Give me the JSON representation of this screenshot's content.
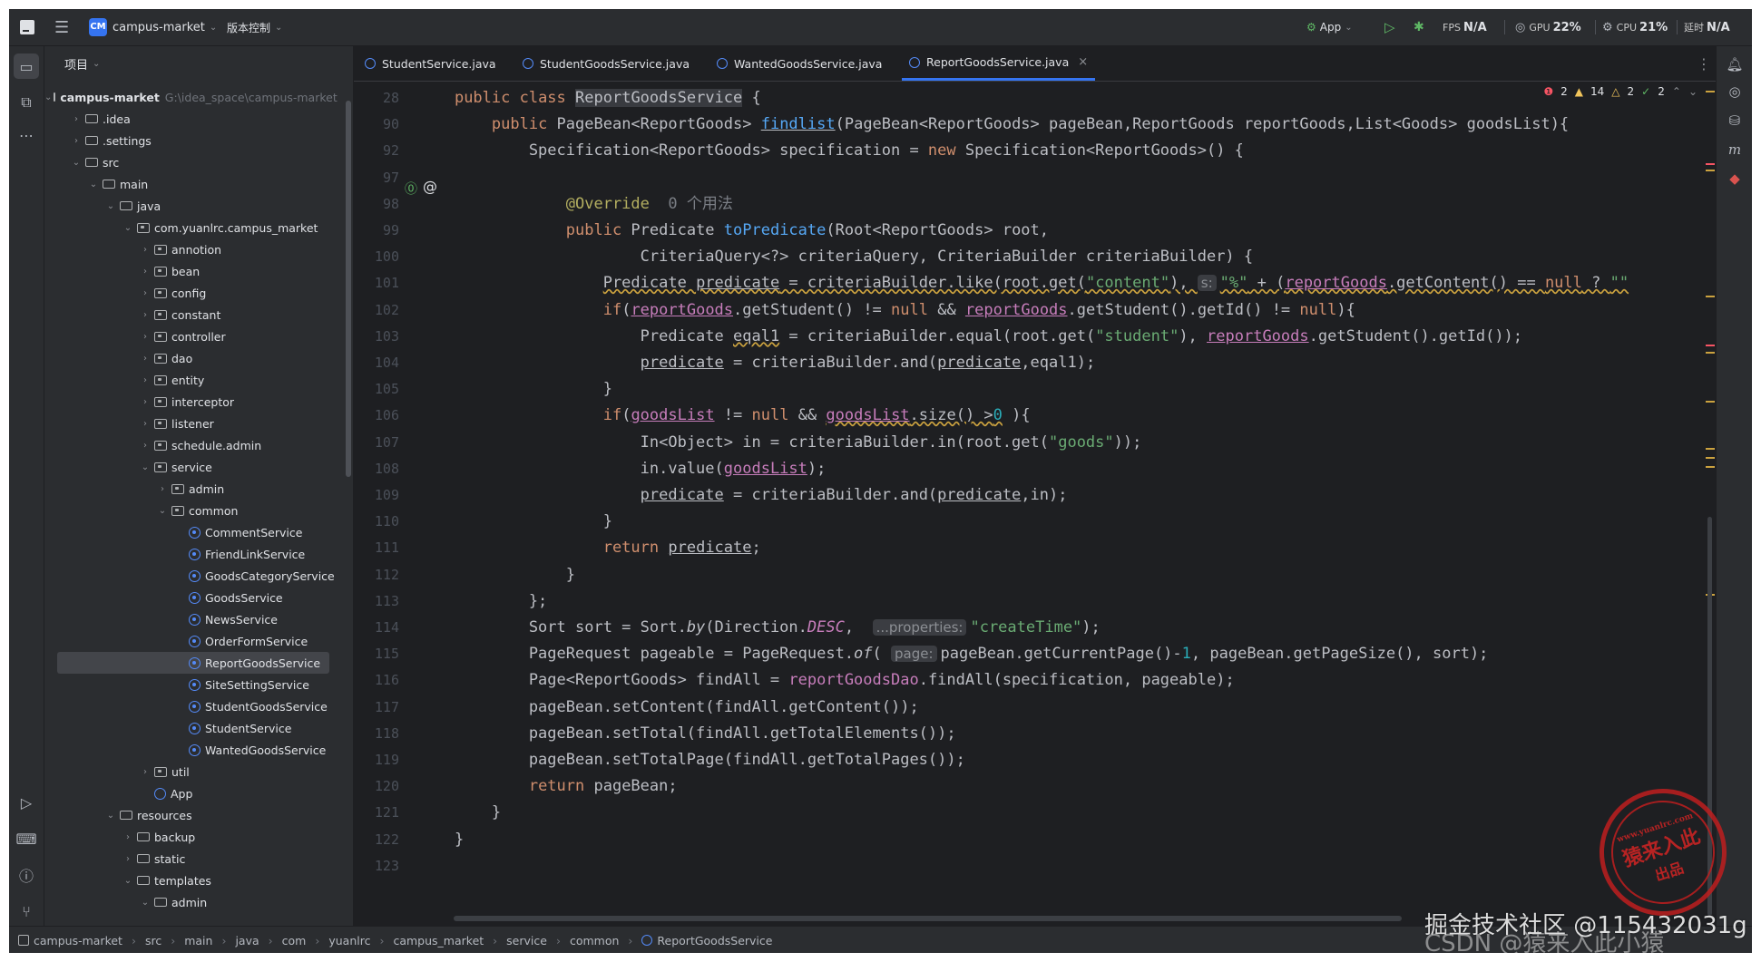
{
  "titlebar": {
    "project_badge": "CM",
    "project_name": "campus-market",
    "vcs": "版本控制",
    "run_config": "App",
    "fps_label": "FPS",
    "fps_value": "N/A",
    "gpu_label": "GPU",
    "gpu_value": "22%",
    "cpu_label": "CPU",
    "cpu_value": "21%",
    "time_label": "延时",
    "time_value": "N/A"
  },
  "project_panel": {
    "header": "项目",
    "tree": [
      {
        "label": "campus-market",
        "path": "G:\\idea_space\\campus-market",
        "indent": 0,
        "arrow": "open",
        "icon": "module",
        "bold": true
      },
      {
        "label": ".idea",
        "indent": 1,
        "arrow": "closed",
        "icon": "folder"
      },
      {
        "label": ".settings",
        "indent": 1,
        "arrow": "closed",
        "icon": "folder"
      },
      {
        "label": "src",
        "indent": 1,
        "arrow": "open",
        "icon": "folder"
      },
      {
        "label": "main",
        "indent": 2,
        "arrow": "open",
        "icon": "folder"
      },
      {
        "label": "java",
        "indent": 3,
        "arrow": "open",
        "icon": "folder"
      },
      {
        "label": "com.yuanlrc.campus_market",
        "indent": 4,
        "arrow": "open",
        "icon": "package"
      },
      {
        "label": "annotion",
        "indent": 5,
        "arrow": "closed",
        "icon": "package"
      },
      {
        "label": "bean",
        "indent": 5,
        "arrow": "closed",
        "icon": "package"
      },
      {
        "label": "config",
        "indent": 5,
        "arrow": "closed",
        "icon": "package"
      },
      {
        "label": "constant",
        "indent": 5,
        "arrow": "closed",
        "icon": "package"
      },
      {
        "label": "controller",
        "indent": 5,
        "arrow": "closed",
        "icon": "package"
      },
      {
        "label": "dao",
        "indent": 5,
        "arrow": "closed",
        "icon": "package"
      },
      {
        "label": "entity",
        "indent": 5,
        "arrow": "closed",
        "icon": "package"
      },
      {
        "label": "interceptor",
        "indent": 5,
        "arrow": "closed",
        "icon": "package"
      },
      {
        "label": "listener",
        "indent": 5,
        "arrow": "closed",
        "icon": "package"
      },
      {
        "label": "schedule.admin",
        "indent": 5,
        "arrow": "closed",
        "icon": "package"
      },
      {
        "label": "service",
        "indent": 5,
        "arrow": "open",
        "icon": "package"
      },
      {
        "label": "admin",
        "indent": 6,
        "arrow": "closed",
        "icon": "package"
      },
      {
        "label": "common",
        "indent": 6,
        "arrow": "open",
        "icon": "package"
      },
      {
        "label": "CommentService",
        "indent": 7,
        "arrow": "",
        "icon": "class"
      },
      {
        "label": "FriendLinkService",
        "indent": 7,
        "arrow": "",
        "icon": "class"
      },
      {
        "label": "GoodsCategoryService",
        "indent": 7,
        "arrow": "",
        "icon": "class"
      },
      {
        "label": "GoodsService",
        "indent": 7,
        "arrow": "",
        "icon": "class"
      },
      {
        "label": "NewsService",
        "indent": 7,
        "arrow": "",
        "icon": "class"
      },
      {
        "label": "OrderFormService",
        "indent": 7,
        "arrow": "",
        "icon": "class"
      },
      {
        "label": "ReportGoodsService",
        "indent": 7,
        "arrow": "",
        "icon": "class",
        "selected": true
      },
      {
        "label": "SiteSettingService",
        "indent": 7,
        "arrow": "",
        "icon": "class"
      },
      {
        "label": "StudentGoodsService",
        "indent": 7,
        "arrow": "",
        "icon": "class"
      },
      {
        "label": "StudentService",
        "indent": 7,
        "arrow": "",
        "icon": "class"
      },
      {
        "label": "WantedGoodsService",
        "indent": 7,
        "arrow": "",
        "icon": "class"
      },
      {
        "label": "util",
        "indent": 5,
        "arrow": "closed",
        "icon": "package"
      },
      {
        "label": "App",
        "indent": 5,
        "arrow": "",
        "icon": "java"
      },
      {
        "label": "resources",
        "indent": 3,
        "arrow": "open",
        "icon": "folder"
      },
      {
        "label": "backup",
        "indent": 4,
        "arrow": "closed",
        "icon": "folder"
      },
      {
        "label": "static",
        "indent": 4,
        "arrow": "closed",
        "icon": "folder"
      },
      {
        "label": "templates",
        "indent": 4,
        "arrow": "open",
        "icon": "folder"
      },
      {
        "label": "admin",
        "indent": 5,
        "arrow": "open",
        "icon": "folder"
      }
    ]
  },
  "tabs": [
    {
      "label": "StudentService.java",
      "active": false
    },
    {
      "label": "StudentGoodsService.java",
      "active": false
    },
    {
      "label": "WantedGoodsService.java",
      "active": false
    },
    {
      "label": "ReportGoodsService.java",
      "active": true
    }
  ],
  "inspections": {
    "errors": "2",
    "warnings": "14",
    "weak_warnings": "2",
    "ok": "2"
  },
  "editor": {
    "lines": [
      {
        "n": "28",
        "html": "    <span class=\"kw\">public class</span> <span class=\"highlight\">ReportGoodsService</span> {"
      },
      {
        "n": "90",
        "html": "        <span class=\"kw\">public</span> PageBean&lt;ReportGoods&gt; <span class=\"fn under\">findlist</span>(PageBean&lt;ReportGoods&gt; pageBean,ReportGoods reportGoods,List&lt;Goods&gt; goodsList){"
      },
      {
        "n": "92",
        "html": "            Specification&lt;ReportGoods&gt; specification = <span class=\"kw\">new</span> Specification&lt;ReportGoods&gt;() {"
      },
      {
        "n": "97",
        "html": ""
      },
      {
        "n": "98",
        "html": "                <span class=\"ann\">@Override</span>  <span class=\"cmt\">0 个用法</span>"
      },
      {
        "n": "99",
        "html": "                <span class=\"kw\">public</span> Predicate <span class=\"fn\">toPredicate</span>(Root&lt;ReportGoods&gt; root,"
      },
      {
        "n": "100",
        "html": "                        CriteriaQuery&lt;?&gt; criteriaQuery, CriteriaBuilder criteriaBuilder) {"
      },
      {
        "n": "101",
        "html": "                    <span class=\"warn\">Predicate <span class=\"under\">predicate</span> = criteriaBuilder.like(root.get(<span class=\"str\">\"content\"</span>), </span><span class=\"hint\">s:</span><span class=\"warn\"><span class=\"str\">\"%\"</span> + (<span class=\"ufld\">reportGoods</span>.getContent() == <span class=\"kw\">null</span> ? <span class=\"str\">\"\"</span></span>"
      },
      {
        "n": "102",
        "html": "                    <span class=\"kw\">if</span>(<span class=\"ufld\">reportGoods</span>.getStudent() != <span class=\"kw\">null</span> &amp;&amp; <span class=\"ufld\">reportGoods</span>.getStudent().getId() != <span class=\"kw\">null</span>){"
      },
      {
        "n": "103",
        "html": "                        Predicate <span class=\"warn\">eqal1</span> = criteriaBuilder.equal(root.get(<span class=\"str\">\"student\"</span>), <span class=\"ufld\">reportGoods</span>.getStudent().getId());"
      },
      {
        "n": "104",
        "html": "                        <span class=\"under\">predicate</span> = criteriaBuilder.and(<span class=\"under\">predicate</span>,eqal1);"
      },
      {
        "n": "105",
        "html": "                    }"
      },
      {
        "n": "106",
        "html": "                    <span class=\"kw\">if</span>(<span class=\"ufld\">goodsList</span> != <span class=\"kw\">null</span> &amp;&amp; <span class=\"warn\"><span class=\"ufld\">goodsList</span>.size() &gt;<span class=\"num\">0</span></span> ){"
      },
      {
        "n": "107",
        "html": "                        In&lt;Object&gt; in = criteriaBuilder.in(root.get(<span class=\"str\">\"goods\"</span>));"
      },
      {
        "n": "108",
        "html": "                        in.value(<span class=\"ufld\">goodsList</span>);"
      },
      {
        "n": "109",
        "html": "                        <span class=\"under\">predicate</span> = criteriaBuilder.and(<span class=\"under\">predicate</span>,in);"
      },
      {
        "n": "110",
        "html": "                    }"
      },
      {
        "n": "111",
        "html": "                    <span class=\"kw\">return</span> <span class=\"under\">predicate</span>;"
      },
      {
        "n": "112",
        "html": "                }"
      },
      {
        "n": "113",
        "html": "            };"
      },
      {
        "n": "114",
        "html": "            Sort sort = Sort.<span class=\"ital\">by</span>(Direction.<span class=\"fld ital\">DESC</span>,  <span class=\"hint\">...properties:</span><span class=\"str\">\"createTime\"</span>);"
      },
      {
        "n": "115",
        "html": "            PageRequest pageable = PageRequest.<span class=\"ital\">of</span>( <span class=\"hint\">page:</span>pageBean.getCurrentPage()-<span class=\"num\">1</span>, pageBean.getPageSize(), sort);"
      },
      {
        "n": "116",
        "html": "            Page&lt;ReportGoods&gt; findAll = <span class=\"fld\">reportGoodsDao</span>.findAll(specification, pageable);"
      },
      {
        "n": "117",
        "html": "            pageBean.setContent(findAll.getContent());"
      },
      {
        "n": "118",
        "html": "            pageBean.setTotal(findAll.getTotalElements());"
      },
      {
        "n": "119",
        "html": "            pageBean.setTotalPage(findAll.getTotalPages());"
      },
      {
        "n": "120",
        "html": "            <span class=\"kw\">return</span> pageBean;"
      },
      {
        "n": "121",
        "html": "        }"
      },
      {
        "n": "122",
        "html": "    }"
      },
      {
        "n": "123",
        "html": ""
      }
    ]
  },
  "breadcrumbs": [
    "campus-market",
    "src",
    "main",
    "java",
    "com",
    "yuanlrc",
    "campus_market",
    "service",
    "common",
    "ReportGoodsService"
  ],
  "watermarks": {
    "platform": "掘金技术社区",
    "csdn": "CSDN @猿来入此小猿",
    "handle": "@115432031g",
    "stamp_line1": "猿来入此",
    "stamp_line2": "出品",
    "stamp_url": "www.yuanlrc.com"
  }
}
